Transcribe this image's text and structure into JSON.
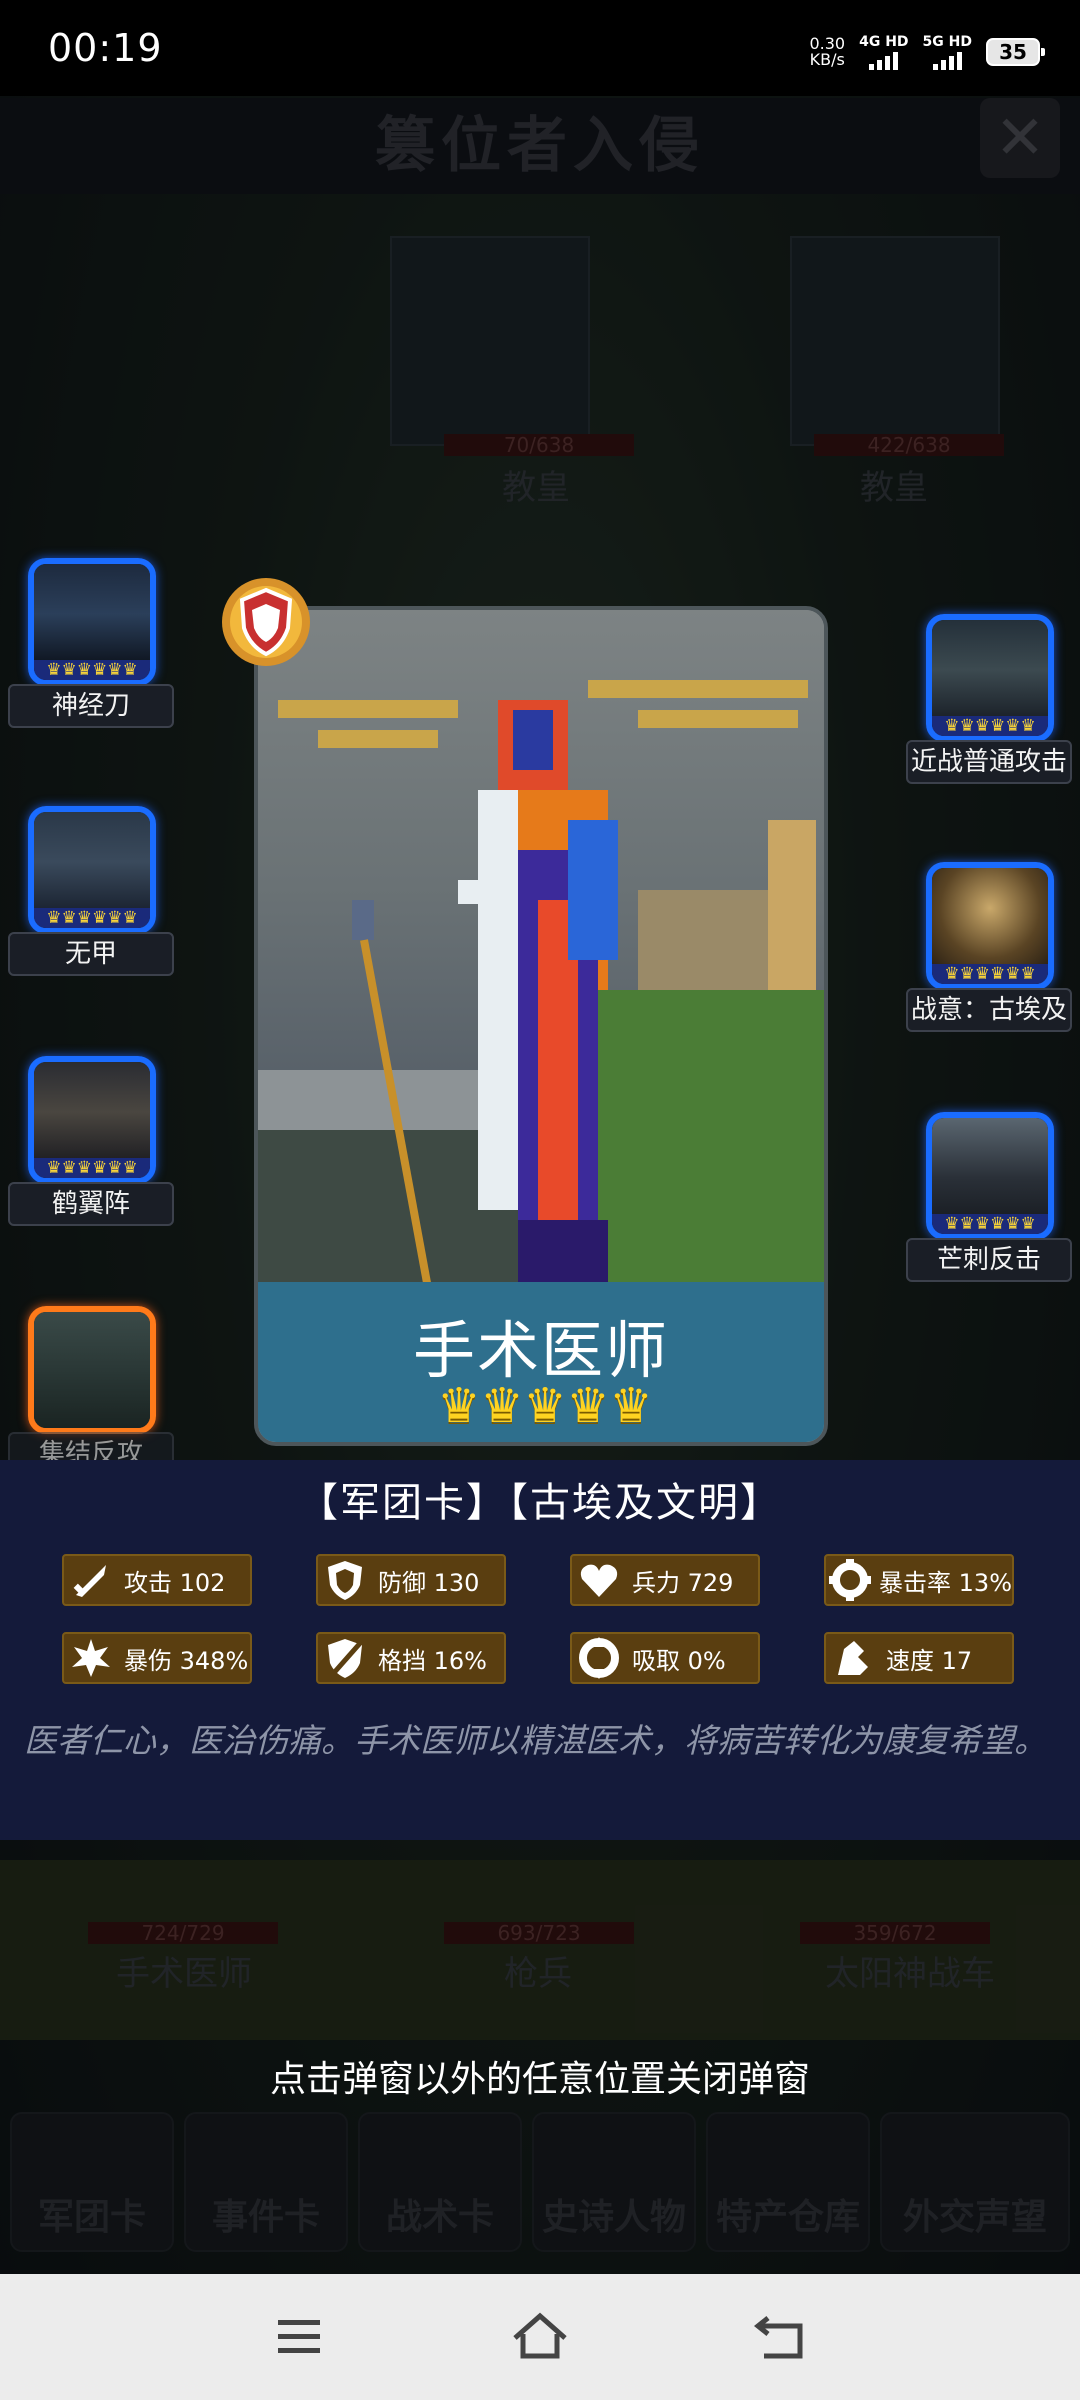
{
  "status_bar": {
    "time": "00:19",
    "speed_value": "0.30",
    "speed_unit": "KB/s",
    "net1": "4G HD",
    "net2": "5G HD",
    "battery": "35"
  },
  "background": {
    "title": "篡位者入侵",
    "enemies": [
      {
        "hp": "70/638",
        "name": "教皇"
      },
      {
        "hp": "422/638",
        "name": "教皇"
      }
    ],
    "allies": [
      {
        "hp": "724/729",
        "name": "手术医师"
      },
      {
        "hp": "693/723",
        "name": "枪兵"
      },
      {
        "hp": "359/672",
        "name": "太阳神战车"
      }
    ],
    "tabs": [
      "军团卡",
      "事件卡",
      "战术卡",
      "史诗人物",
      "特产仓库",
      "外交声望"
    ]
  },
  "skills_left": [
    {
      "label": "神经刀",
      "crowns": "♛♛♛♛♛♛"
    },
    {
      "label": "无甲",
      "crowns": "♛♛♛♛♛♛"
    },
    {
      "label": "鹤翼阵",
      "crowns": "♛♛♛♛♛♛"
    },
    {
      "label": "集结反攻",
      "crowns": "♛♛♛♛♛♛"
    }
  ],
  "skills_right": [
    {
      "label": "近战普通攻击",
      "crowns": "♛♛♛♛♛♛"
    },
    {
      "label": "战意：古埃及",
      "crowns": "♛♛♛♛♛♛"
    },
    {
      "label": "芒刺反击",
      "crowns": "♛♛♛♛♛♛"
    }
  ],
  "card": {
    "name": "手术医师",
    "crowns": "♛♛♛♛♛"
  },
  "panel": {
    "title": "【军团卡】【古埃及文明】",
    "stats": [
      {
        "icon": "sword-icon",
        "label": "攻击",
        "value": "102"
      },
      {
        "icon": "shield-icon",
        "label": "防御",
        "value": "130"
      },
      {
        "icon": "heart-icon",
        "label": "兵力",
        "value": "729"
      },
      {
        "icon": "crit-rate-icon",
        "label": "暴击率",
        "value": "13%"
      },
      {
        "icon": "crit-damage-icon",
        "label": "暴伤",
        "value": "348%"
      },
      {
        "icon": "block-icon",
        "label": "格挡",
        "value": "16%"
      },
      {
        "icon": "lifesteal-icon",
        "label": "吸取",
        "value": "0%"
      },
      {
        "icon": "speed-icon",
        "label": "速度",
        "value": "17"
      }
    ],
    "description": "医者仁心，医治伤痛。手术医师以精湛医术，将病苦转化为康复希望。"
  },
  "hint": "点击弹窗以外的任意位置关闭弹窗",
  "colors": {
    "panel": "#141a3a",
    "stat_bg": "#5a3e10",
    "skill_border": "#1a6cff",
    "skill_border_active": "#ff7a1a",
    "crown": "#ffd321"
  }
}
